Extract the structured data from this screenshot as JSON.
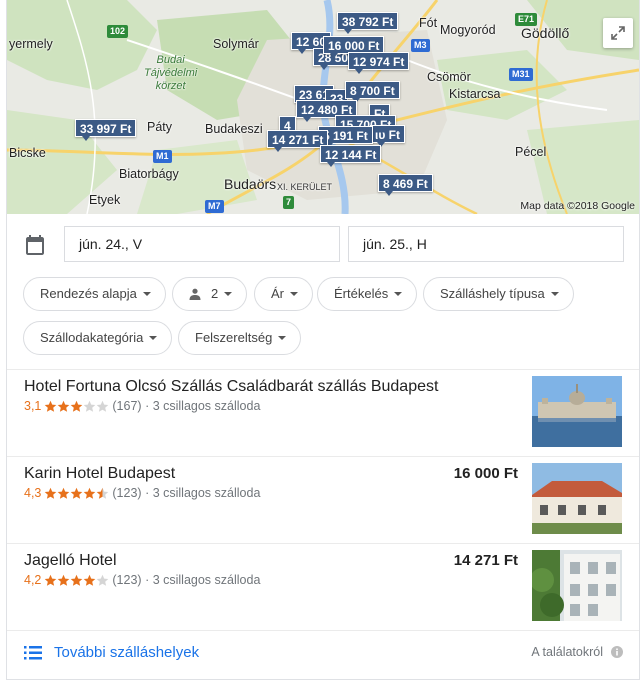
{
  "map": {
    "attribution": "Map data ©2018 Google",
    "labels": {
      "gyermely": "yermely",
      "solymar": "Solymár",
      "budai": "Budai\nTájvédelmi\nkörzet",
      "fot": "Fót",
      "mogyorod": "Mogyoród",
      "godollo": "Gödöllő",
      "csomor": "Csömör",
      "kistarcsa": "Kistarcsa",
      "paty": "Páty",
      "budakeszi": "Budakeszi",
      "bicske": "Bicske",
      "biatorbagy": "Biatorbágy",
      "pecel": "Pécel",
      "etyek": "Etyek",
      "budaors": "Budaörs",
      "xi_kerulet": "XI. KERÜLET"
    },
    "shields": {
      "r102": "102",
      "m3": "M3",
      "e71": "E71",
      "m31": "M31",
      "m1": "M1",
      "m7": "M7",
      "r7": "7"
    },
    "prices": {
      "p38792": "38 792 Ft",
      "p12600": "12 60",
      "p16000": "16 000 Ft",
      "p28500": "28 50",
      "p12974": "12 974 Ft",
      "p23610": "23 61",
      "p23b": "23",
      "p8700": "8 700 Ft",
      "p12480": "12 480 Ft",
      "p33997": "33 997 Ft",
      "p4": "4",
      "p15700": "15 700 Ft",
      "p5191": "5 191 Ft",
      "p14271": "14 271 Ft",
      "p12144": "12 144 Ft",
      "p8469": "8 469 Ft",
      "p_ft1": "Ft",
      "p_ft2": "ιυ Ft"
    }
  },
  "dates": {
    "checkin": "jún. 24., V",
    "checkout": "jún. 25., H"
  },
  "filters": {
    "sort": "Rendezés alapja",
    "guests": "2",
    "price": "Ár",
    "rating": "Értékelés",
    "type": "Szálláshely típusa",
    "category": "Szállodakategória",
    "amenities": "Felszereltség"
  },
  "results": [
    {
      "name": "Hotel Fortuna Olcsó Szállás Családbarát szállás Budapest",
      "rating": "3,1",
      "stars": 3,
      "reviews": "(167)",
      "category": "· 3 csillagos szálloda",
      "price": ""
    },
    {
      "name": "Karin Hotel Budapest",
      "rating": "4,3",
      "stars": 4.5,
      "reviews": "(123)",
      "category": "· 3 csillagos szálloda",
      "price": "16 000 Ft"
    },
    {
      "name": "Jagelló Hotel",
      "rating": "4,2",
      "stars": 4,
      "reviews": "(123)",
      "category": "· 3 csillagos szálloda",
      "price": "14 271 Ft"
    }
  ],
  "footer": {
    "more": "További szálláshelyek",
    "about": "A találatokról"
  },
  "colors": {
    "pin": "#3c5a85",
    "link": "#1a73e8",
    "star": "#e7711b"
  }
}
